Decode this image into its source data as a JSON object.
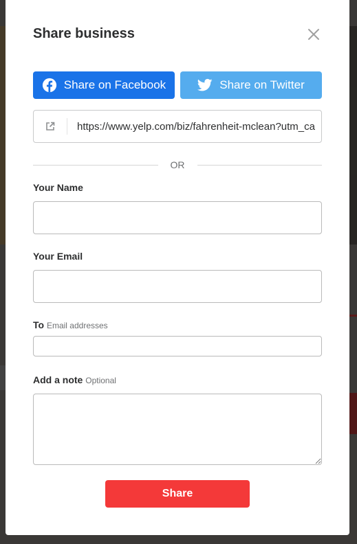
{
  "modal": {
    "title": "Share business",
    "close_icon": "close-icon"
  },
  "social": {
    "facebook_label": "Share on Facebook",
    "facebook_icon": "facebook-icon",
    "facebook_color": "#1a73e8",
    "twitter_label": "Share on Twitter",
    "twitter_icon": "twitter-icon",
    "twitter_color": "#55acee"
  },
  "share_link": {
    "icon": "external-link-icon",
    "url": "https://www.yelp.com/biz/fahrenheit-mclean?utm_ca"
  },
  "divider_text": "OR",
  "form": {
    "name_label": "Your Name",
    "name_value": "",
    "email_label": "Your Email",
    "email_value": "",
    "to_label": "To",
    "to_hint": "Email addresses",
    "to_value": "",
    "note_label": "Add a note",
    "note_hint": "Optional",
    "note_value": ""
  },
  "submit_label": "Share",
  "submit_color": "#f43939"
}
